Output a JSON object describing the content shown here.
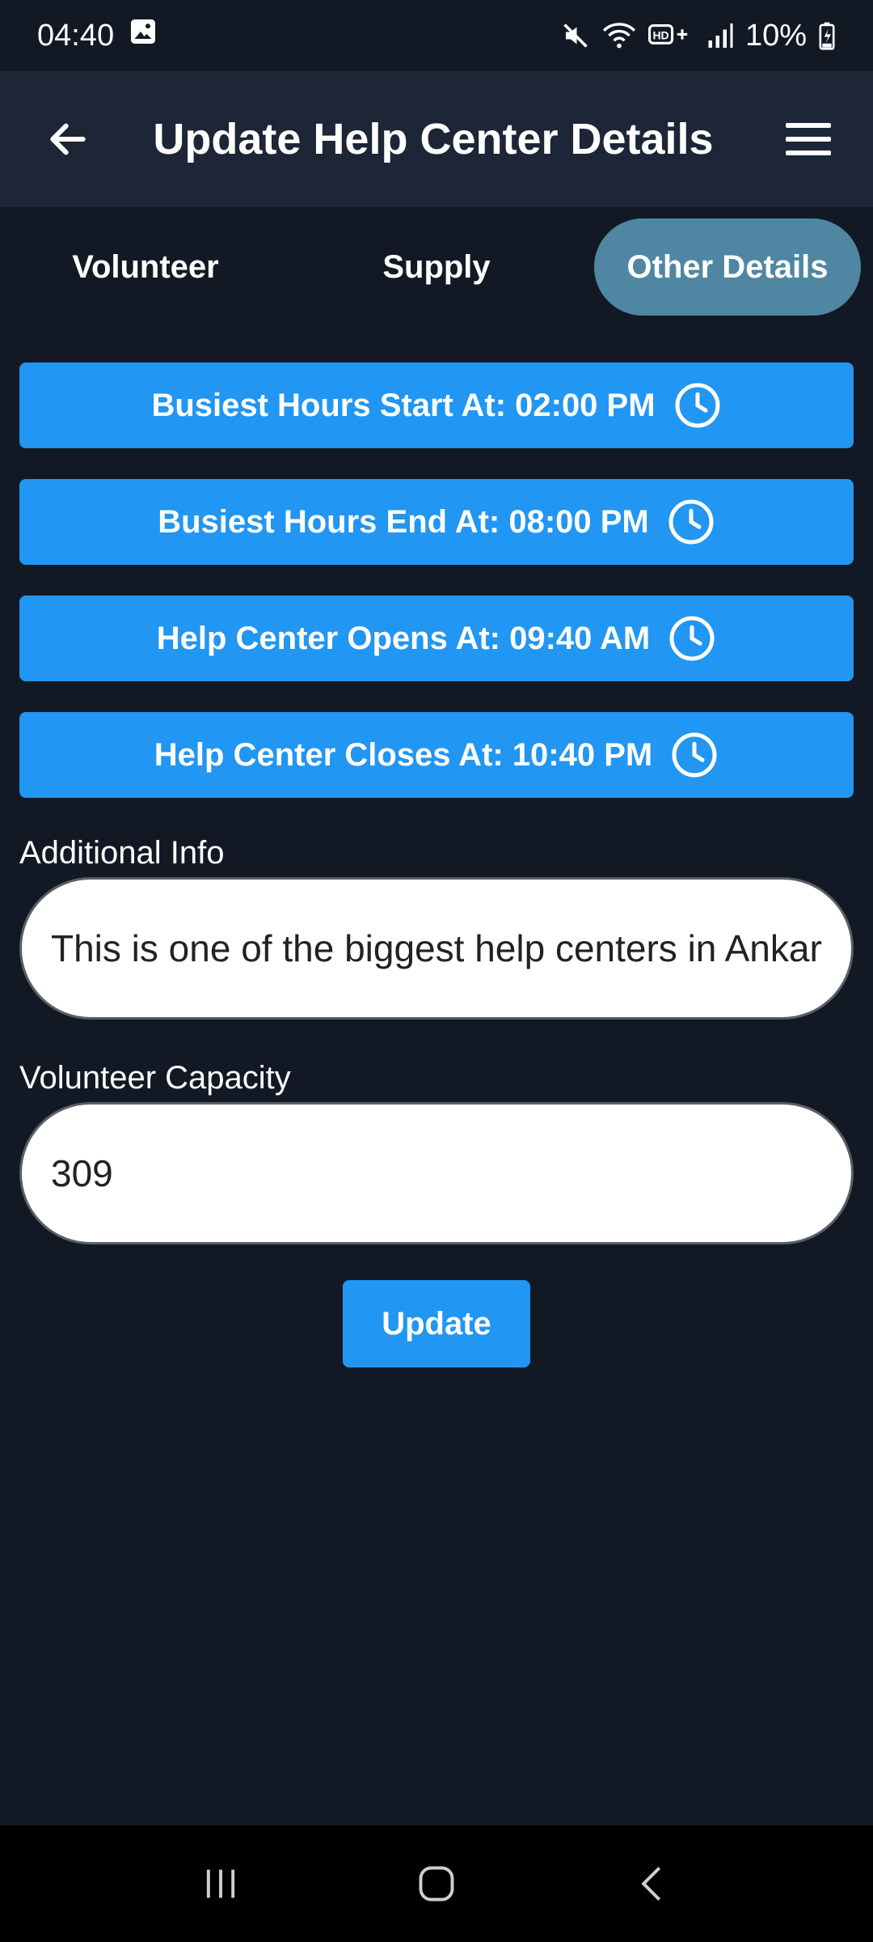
{
  "status_bar": {
    "time": "04:40",
    "battery": "10%",
    "icons": [
      "gallery-icon",
      "mute-icon",
      "wifi-icon",
      "hd-voice-icon",
      "signal-icon",
      "battery-charging-icon"
    ]
  },
  "app_bar": {
    "title": "Update Help Center Details",
    "back_icon": "back-arrow-icon",
    "menu_icon": "hamburger-menu-icon"
  },
  "tabs": [
    {
      "label": "Volunteer",
      "selected": false
    },
    {
      "label": "Supply",
      "selected": false
    },
    {
      "label": "Other Details",
      "selected": true
    }
  ],
  "time_buttons": [
    {
      "label": "Busiest Hours Start At: 02:00 PM",
      "icon": "clock-icon"
    },
    {
      "label": "Busiest Hours End At: 08:00 PM",
      "icon": "clock-icon"
    },
    {
      "label": "Help Center Opens At: 09:40 AM",
      "icon": "clock-icon"
    },
    {
      "label": "Help Center Closes At: 10:40 PM",
      "icon": "clock-icon"
    }
  ],
  "fields": {
    "additional_info": {
      "label": "Additional Info",
      "value": "This is one of the biggest help centers in Ankara"
    },
    "volunteer_capacity": {
      "label": "Volunteer Capacity",
      "value": "309"
    }
  },
  "update_button": {
    "label": "Update"
  },
  "colors": {
    "background": "#131924",
    "app_bar": "#1c2636",
    "primary_button": "#2196f3",
    "selected_tab": "#4f87a2"
  }
}
